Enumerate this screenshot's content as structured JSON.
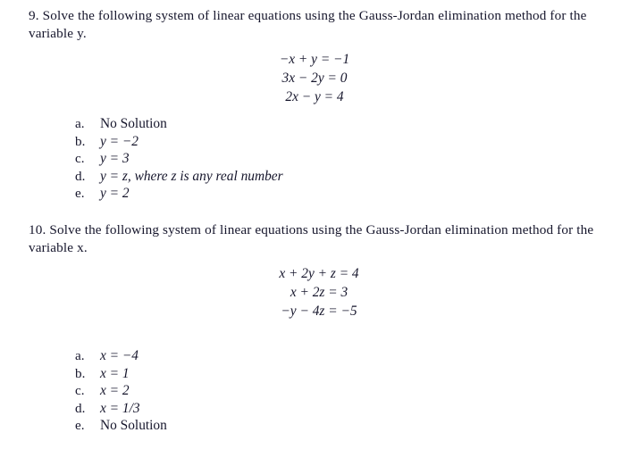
{
  "document": {
    "background_color": "#ffffff",
    "text_color": "#16162c"
  },
  "questions": [
    {
      "id": "question-9",
      "number": "9.",
      "stem": "9.  Solve the following system of linear equations using the Gauss-Jordan elimination method for the variable y.",
      "variable": "y",
      "equations": [
        "−x + y = −1",
        "3x − 2y = 0",
        "2x − y = 4"
      ],
      "choices": [
        {
          "letter": "a.",
          "text": "No Solution"
        },
        {
          "letter": "b.",
          "text": "y = −2"
        },
        {
          "letter": "c.",
          "text": "y = 3"
        },
        {
          "letter": "d.",
          "text": "y = z, where z is any real number"
        },
        {
          "letter": "e.",
          "text": "y = 2"
        }
      ]
    },
    {
      "id": "question-10",
      "number": "10.",
      "stem": "10.  Solve the following system of linear equations using the Gauss-Jordan elimination method for the variable x.",
      "variable": "x",
      "equations": [
        "x + 2y + z = 4",
        "x + 2z = 3",
        "−y − 4z = −5"
      ],
      "choices": [
        {
          "letter": "a.",
          "text": "x = −4"
        },
        {
          "letter": "b.",
          "text": "x = 1"
        },
        {
          "letter": "c.",
          "text": "x = 2"
        },
        {
          "letter": "d.",
          "text": "x = 1/3"
        },
        {
          "letter": "e.",
          "text": "No Solution"
        }
      ]
    }
  ]
}
